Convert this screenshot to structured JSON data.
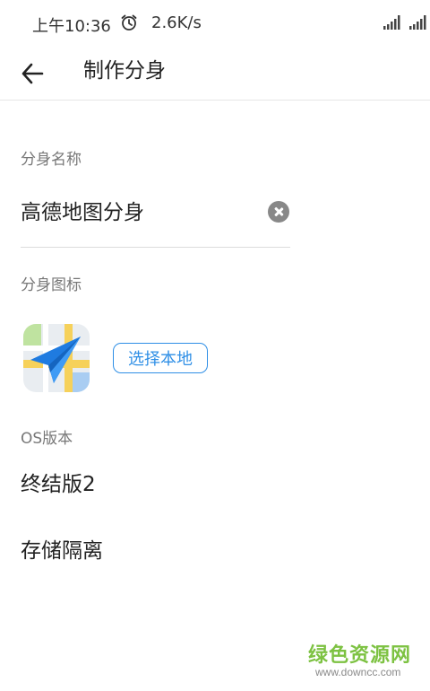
{
  "status_bar": {
    "time": "上午10:36",
    "network_speed": "2.6K/s",
    "alarm_icon": "alarm-clock-icon",
    "signal_icons": [
      "signal-bars-icon",
      "signal-bars-icon"
    ]
  },
  "app_bar": {
    "back_icon": "arrow-left-icon",
    "title": "制作分身"
  },
  "form": {
    "name_label": "分身名称",
    "name_value": "高德地图分身",
    "clear_icon": "clear-circle-icon",
    "icon_label": "分身图标",
    "app_icon": "amap-paper-plane-icon",
    "choose_local_label": "选择本地",
    "os_label": "OS版本",
    "os_value": "终结版2",
    "storage_value": "存储隔离"
  },
  "watermark": {
    "main": "绿色资源网",
    "url": "www.downcc.com"
  },
  "colors": {
    "accent": "#2f8fe6",
    "label_gray": "#777777",
    "watermark_green": "#7dc242"
  }
}
